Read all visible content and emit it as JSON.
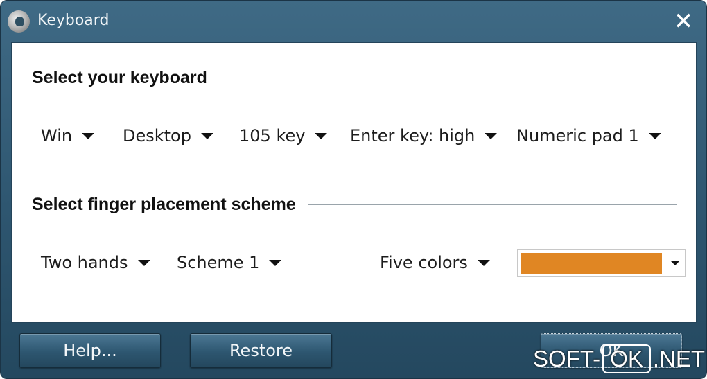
{
  "window": {
    "title": "Keyboard",
    "close_glyph": "✕",
    "icon": "app-logo-icon"
  },
  "keyboard_section": {
    "title": "Select your keyboard",
    "dropdowns": [
      {
        "label": "Win"
      },
      {
        "label": "Desktop"
      },
      {
        "label": "105 key"
      },
      {
        "label": "Enter key: high"
      },
      {
        "label": "Numeric pad 1"
      }
    ]
  },
  "finger_section": {
    "title": "Select finger placement scheme",
    "dropdowns": [
      {
        "label": "Two hands"
      },
      {
        "label": "Scheme 1"
      },
      {
        "label": "Five colors"
      }
    ],
    "color_combo": {
      "selected_color": "#e08623"
    }
  },
  "buttons": {
    "help": "Help...",
    "restore": "Restore",
    "ok": "OK"
  },
  "watermark": {
    "left": "SOFT-",
    "boxed": "OK",
    "right": ".NET"
  },
  "colors": {
    "title_bar": "#2e5670",
    "content_bg": "#ffffff",
    "swatch": "#e08623"
  }
}
